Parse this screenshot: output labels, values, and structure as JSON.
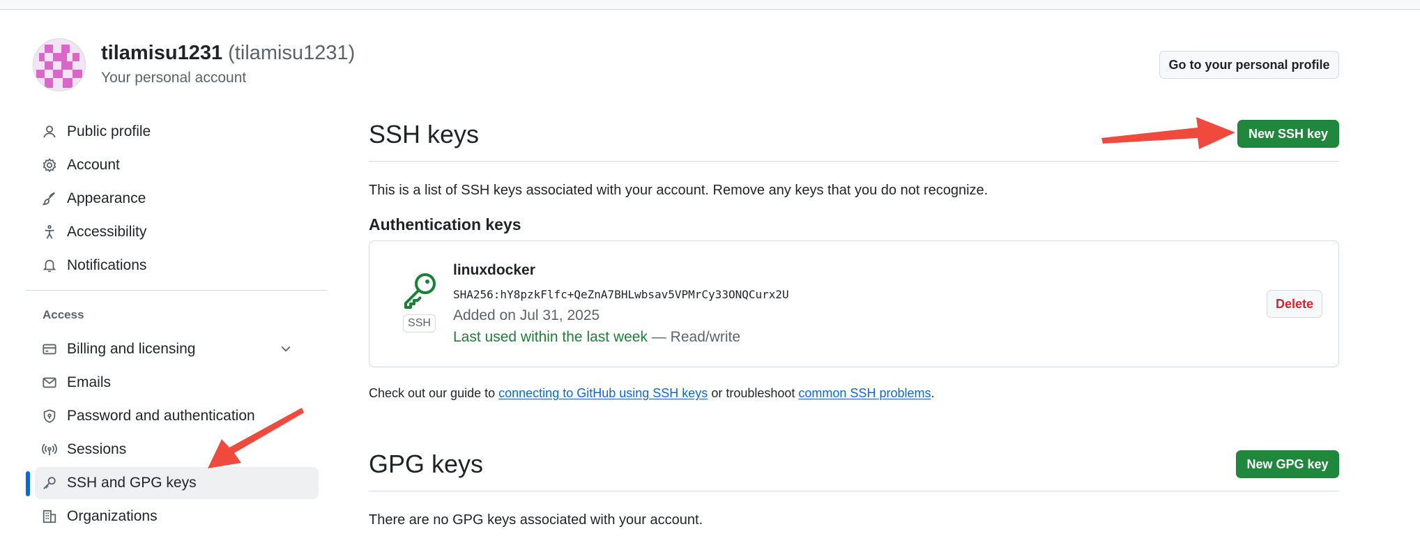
{
  "header": {
    "user_name": "tilamisu1231",
    "user_login": "(tilamisu1231)",
    "account_type": "Your personal account",
    "profile_button": "Go to your personal profile"
  },
  "sidebar": {
    "items": [
      {
        "label": "Public profile",
        "icon": "person-icon"
      },
      {
        "label": "Account",
        "icon": "gear-icon"
      },
      {
        "label": "Appearance",
        "icon": "paintbrush-icon"
      },
      {
        "label": "Accessibility",
        "icon": "accessibility-icon"
      },
      {
        "label": "Notifications",
        "icon": "bell-icon"
      }
    ],
    "access_heading": "Access",
    "access_items": [
      {
        "label": "Billing and licensing",
        "icon": "credit-card-icon"
      },
      {
        "label": "Emails",
        "icon": "mail-icon"
      },
      {
        "label": "Password and authentication",
        "icon": "shield-lock-icon"
      },
      {
        "label": "Sessions",
        "icon": "broadcast-icon"
      },
      {
        "label": "SSH and GPG keys",
        "icon": "key-icon",
        "active": true
      },
      {
        "label": "Organizations",
        "icon": "organization-icon"
      }
    ]
  },
  "ssh": {
    "title": "SSH keys",
    "new_button": "New SSH key",
    "description": "This is a list of SSH keys associated with your account. Remove any keys that you do not recognize.",
    "auth_heading": "Authentication keys",
    "keys": [
      {
        "title": "linuxdocker",
        "type_label": "SSH",
        "fingerprint": "SHA256:hY8pzkFlfc+QeZnA7BHLwbsav5VPMrCy33ONQCurx2U",
        "added": "Added on Jul 31, 2025",
        "last_used": "Last used within the last week",
        "access": "— Read/write",
        "delete_label": "Delete"
      }
    ],
    "guide_prefix": "Check out our guide to",
    "guide_link": "connecting to GitHub using SSH keys",
    "guide_middle": "or troubleshoot",
    "guide_link2": "common SSH problems",
    "guide_suffix": "."
  },
  "gpg": {
    "title": "GPG keys",
    "new_button": "New GPG key",
    "empty_text": "There are no GPG keys associated with your account."
  },
  "colors": {
    "accent_green": "#1f883d",
    "link_blue": "#0969da",
    "danger_red": "#d1242f",
    "annotation_red": "#f04a3e"
  }
}
